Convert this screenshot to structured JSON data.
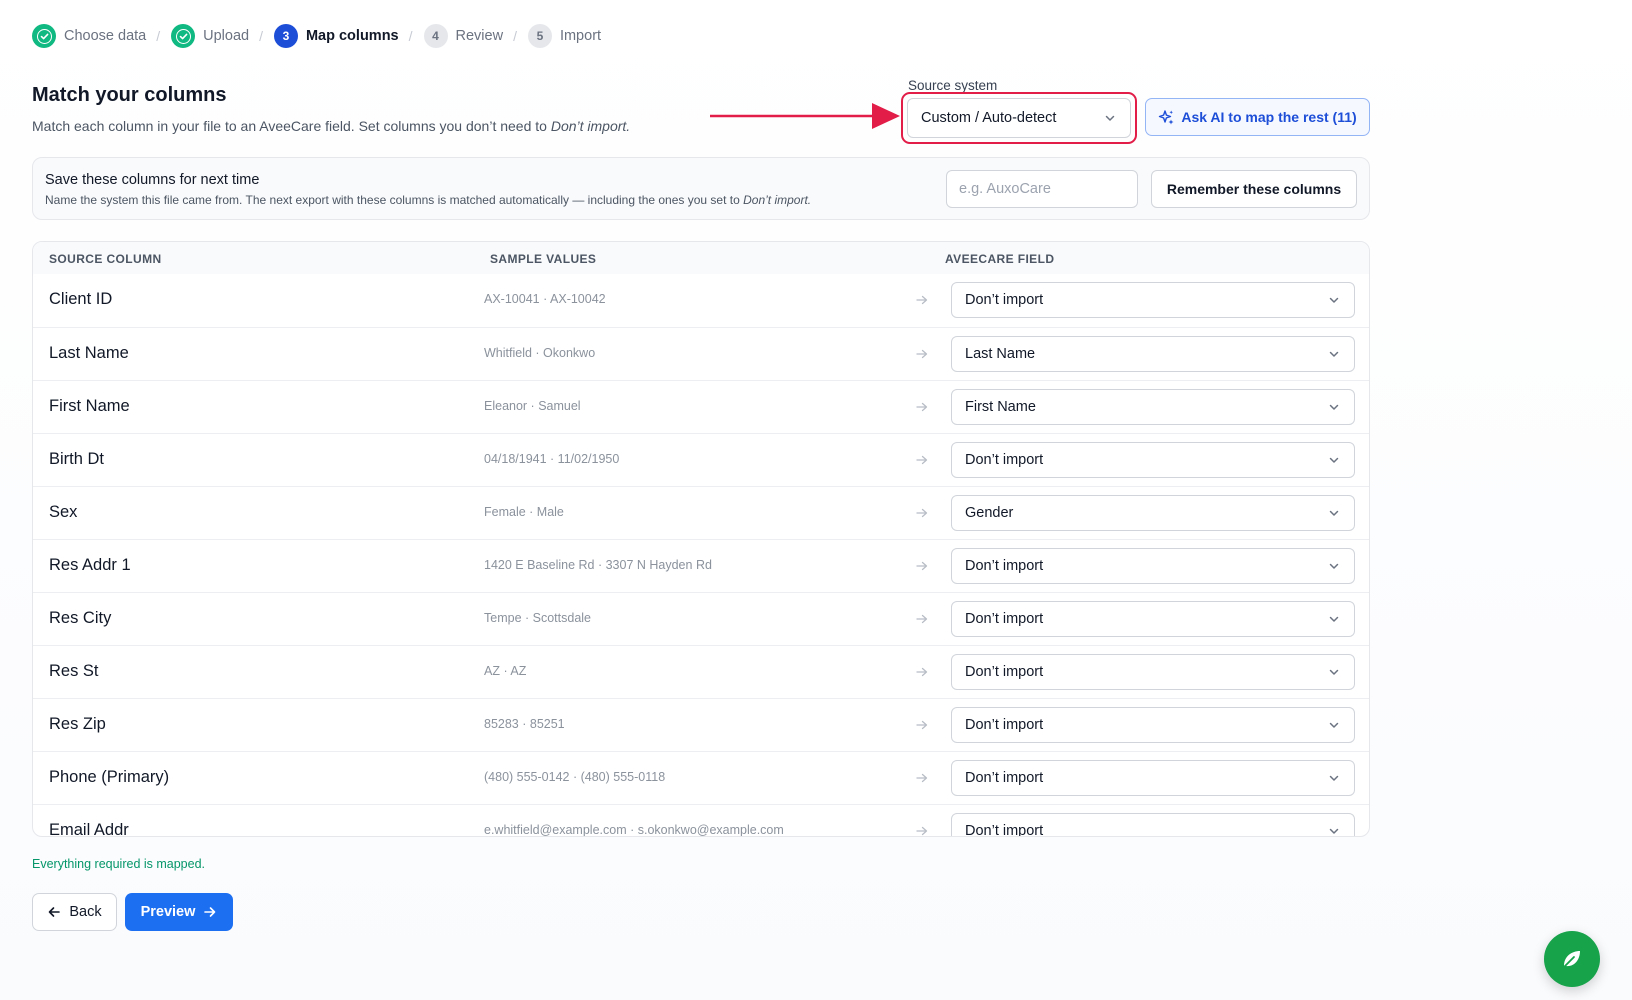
{
  "stepper": {
    "steps": [
      {
        "number": "1",
        "label": "Choose data",
        "state": "done"
      },
      {
        "number": "2",
        "label": "Upload",
        "state": "done"
      },
      {
        "number": "3",
        "label": "Map columns",
        "state": "current"
      },
      {
        "number": "4",
        "label": "Review",
        "state": "todo"
      },
      {
        "number": "5",
        "label": "Import",
        "state": "todo"
      }
    ],
    "separator": "/"
  },
  "header": {
    "title": "Match your columns",
    "subtitle": "Match each column in your file to an AveeCare field. Set columns you don’t need to",
    "subtitle_emphasis": "Don’t import."
  },
  "source_system": {
    "label": "Source system",
    "value": "Custom / Auto-detect"
  },
  "ai_button": {
    "label": "Ask AI to map the rest (11)"
  },
  "save_panel": {
    "title": "Save these columns for next time",
    "description": "Name the system this file came from. The next export with these columns is matched automatically — including the ones you set to",
    "description_emphasis": "Don’t import.",
    "input_placeholder": "e.g. AuxoCare",
    "button_label": "Remember these columns"
  },
  "table": {
    "headers": [
      "SOURCE COLUMN",
      "SAMPLE VALUES",
      "AVEECARE FIELD"
    ],
    "rows": [
      {
        "source": "Client ID",
        "sample": "AX-10041 · AX-10042",
        "field": "Don’t import"
      },
      {
        "source": "Last Name",
        "sample": "Whitfield · Okonkwo",
        "field": "Last Name"
      },
      {
        "source": "First Name",
        "sample": "Eleanor · Samuel",
        "field": "First Name"
      },
      {
        "source": "Birth Dt",
        "sample": "04/18/1941 · 11/02/1950",
        "field": "Don’t import"
      },
      {
        "source": "Sex",
        "sample": "Female · Male",
        "field": "Gender"
      },
      {
        "source": "Res Addr 1",
        "sample": "1420 E Baseline Rd · 3307 N Hayden Rd",
        "field": "Don’t import"
      },
      {
        "source": "Res City",
        "sample": "Tempe · Scottsdale",
        "field": "Don’t import"
      },
      {
        "source": "Res St",
        "sample": "AZ · AZ",
        "field": "Don’t import"
      },
      {
        "source": "Res Zip",
        "sample": "85283 · 85251",
        "field": "Don’t import"
      },
      {
        "source": "Phone (Primary)",
        "sample": "(480) 555-0142 · (480) 555-0118",
        "field": "Don’t import"
      },
      {
        "source": "Email Addr",
        "sample": "e.whitfield@example.com · s.okonkwo@example.com",
        "field": "Don’t import"
      }
    ]
  },
  "status": {
    "message": "Everything required is mapped."
  },
  "footer": {
    "back_label": "Back",
    "preview_label": "Preview"
  },
  "colors": {
    "accent": "#1d4ed8",
    "primary_button": "#1d6ff2",
    "success": "#10b981",
    "highlight": "#e11d48",
    "fab": "#16a34a"
  },
  "icons": {
    "done_step": "check-circle-icon",
    "select": "chevron-down-icon",
    "row_arrow": "arrow-right-icon",
    "ai": "sparkles-icon",
    "back": "arrow-left-icon",
    "preview": "arrow-right-icon",
    "fab": "leaf-icon"
  }
}
